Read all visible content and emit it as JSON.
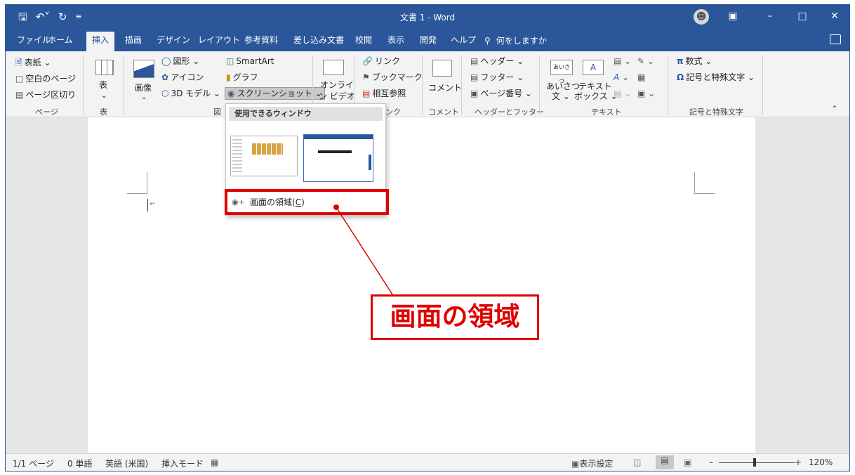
{
  "window": {
    "title": "文書 1  -  Word",
    "controls": [
      "ribbon-display-icon",
      "minimize-icon",
      "maximize-icon",
      "close-icon"
    ]
  },
  "qat": {
    "save_icon": "save-icon",
    "undo_icon": "undo-icon",
    "redo_icon": "redo-icon",
    "customize_icon": "customize-qat-icon"
  },
  "tabs": [
    "ファイル",
    "ホーム",
    "挿入",
    "描画",
    "デザイン",
    "レイアウト",
    "参考資料",
    "差し込み文書",
    "校閲",
    "表示",
    "開発",
    "ヘルプ"
  ],
  "active_tab": "挿入",
  "tellme": "何をしますか",
  "ribbon": {
    "page_group": {
      "label": "ページ",
      "items": [
        "表紙 ⌄",
        "空白のページ",
        "ページ区切り"
      ]
    },
    "table_group": {
      "label": "表",
      "button": "表"
    },
    "illustrations_group": {
      "label": "図",
      "picture": "画像",
      "items": [
        "図形 ⌄",
        "アイコン",
        "3D モデル ⌄",
        "SmartArt",
        "グラフ",
        "スクリーンショット ⌄"
      ]
    },
    "media_group": {
      "button_line1": "オンライ",
      "button_line2": "ン ビデオ"
    },
    "links_group": {
      "label": "リンク",
      "items": [
        "リンク",
        "ブックマーク",
        "相互参照"
      ]
    },
    "comment_group": {
      "label": "コメント",
      "button": "コメント"
    },
    "header_footer_group": {
      "label": "ヘッダーとフッター",
      "items": [
        "ヘッダー ⌄",
        "フッター ⌄",
        "ページ番号 ⌄"
      ]
    },
    "text_group": {
      "label": "テキスト",
      "greeting_line1": "あいさつ",
      "greeting_line2": "文 ⌄",
      "textbox_line1": "テキスト",
      "textbox_line2": "ボックス ⌄",
      "greeting_icon_text": "あいさつ",
      "textbox_icon_text": "A"
    },
    "symbols_group": {
      "label": "記号と特殊文字",
      "items": [
        "数式 ⌄",
        "記号と特殊文字 ⌄"
      ]
    }
  },
  "screenshot_dropdown": {
    "header": "使用できるウィンドウ",
    "menu_item": "画面の領域(C)",
    "menu_item_text": "画面の領域(",
    "menu_item_key": "C",
    "menu_item_end": ")"
  },
  "callout": {
    "text": "画面の領域"
  },
  "statusbar": {
    "page": "1/1 ページ",
    "words": "0 単語",
    "language": "英語 (米国)",
    "mode": "挿入モード",
    "display_settings": "表示設定",
    "zoom": "120%"
  },
  "colors": {
    "accent": "#2b579a",
    "highlight": "#e00000"
  }
}
